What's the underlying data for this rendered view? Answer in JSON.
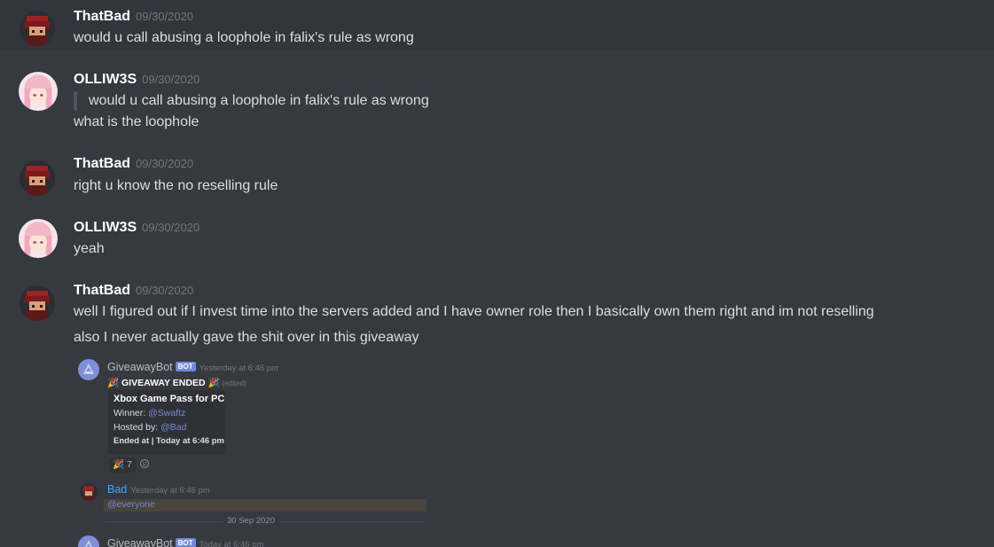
{
  "messages": [
    {
      "author": "ThatBad",
      "timestamp": "09/30/2020",
      "text": "would u call abusing a loophole in falix's rule as wrong"
    },
    {
      "author": "OLLIW3S",
      "timestamp": "09/30/2020",
      "quote": "would u call abusing a loophole in falix's rule as wrong",
      "text": "what is the loophole"
    },
    {
      "author": "ThatBad",
      "timestamp": "09/30/2020",
      "text": "right u know the no reselling rule"
    },
    {
      "author": "OLLIW3S",
      "timestamp": "09/30/2020",
      "text": "yeah"
    },
    {
      "author": "ThatBad",
      "timestamp": "09/30/2020",
      "text": "well I figured out if I invest time into the servers added and I have owner role then I basically own them right and im not reselling",
      "text2": "also I never actually gave the shit over in this giveaway"
    }
  ],
  "screenshot": {
    "bot_name": "GiveawayBot",
    "bot_tag": "BOT",
    "bot_timestamp": "Yesterday at 6:46 pm",
    "giveaway_header": "GIVEAWAY ENDED",
    "edited": "(edited)",
    "embed": {
      "title": "Xbox Game Pass for PC",
      "winner_label": "Winner: ",
      "winner": "@Swaftz",
      "host_label": "Hosted by: ",
      "host": "@Bad",
      "footer": "Ended at | Today at 6:46 pm"
    },
    "reaction_emoji": "🎉",
    "reaction_count": "7",
    "bad_name": "Bad",
    "bad_timestamp": "Yesterday at 6:46 pm",
    "bad_text": "@everyone",
    "date_separator": "30 Sep 2020",
    "bot2_timestamp": "Today at 6:46 pm"
  },
  "colors": {
    "background": "#36393f",
    "mention": "#7289da",
    "timestamp": "#72767d"
  }
}
